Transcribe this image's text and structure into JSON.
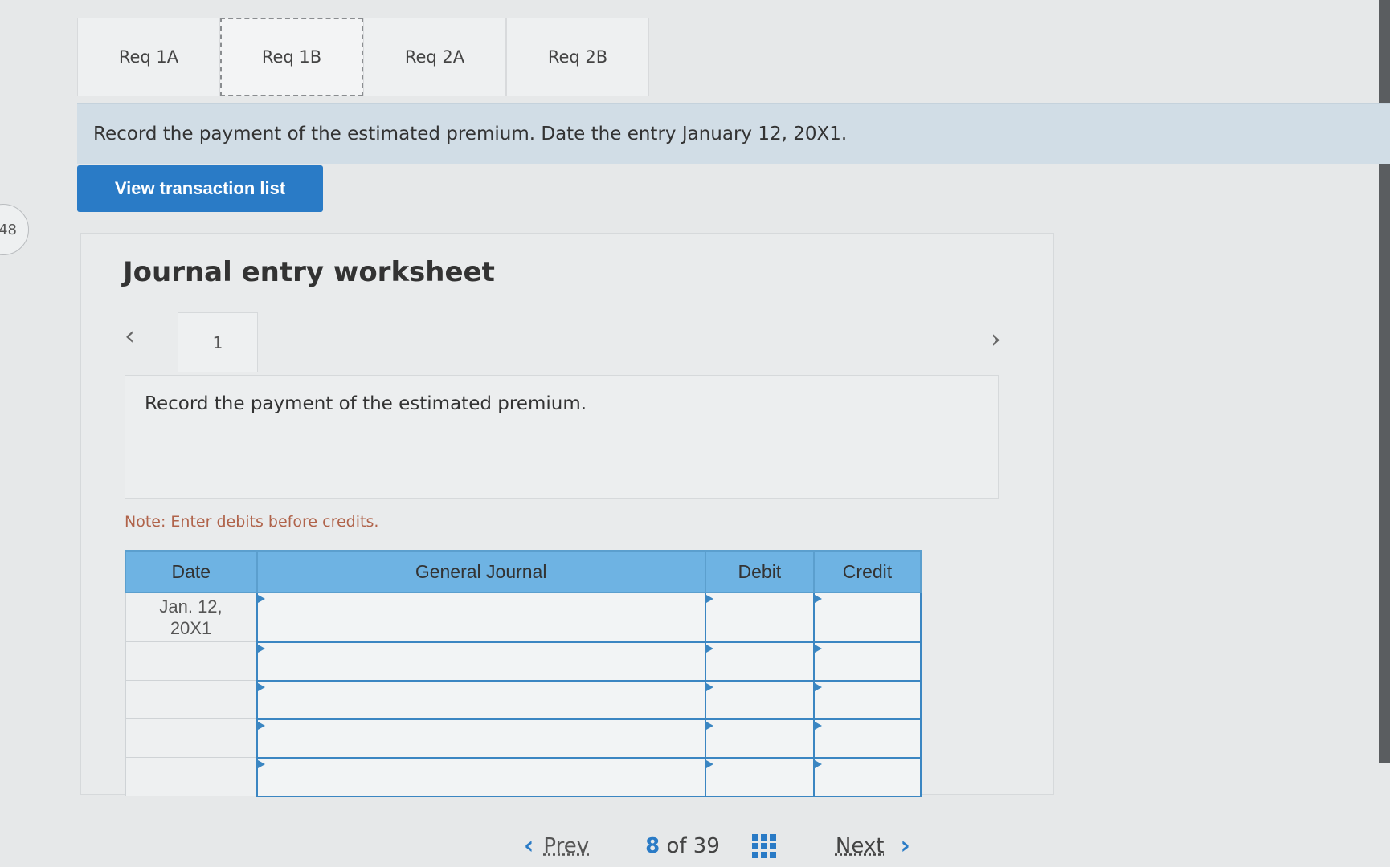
{
  "side_badge": "48",
  "tabs": [
    {
      "label": "Req 1A",
      "active": false
    },
    {
      "label": "Req 1B",
      "active": true
    },
    {
      "label": "Req 2A",
      "active": false
    },
    {
      "label": "Req 2B",
      "active": false
    }
  ],
  "instruction": "Record the payment of the estimated premium. Date the entry January 12, 20X1.",
  "view_transactions_label": "View transaction list",
  "worksheet": {
    "title": "Journal entry worksheet",
    "entry_tab": "1",
    "description": "Record the payment of the estimated premium.",
    "note": "Note: Enter debits before credits."
  },
  "journal": {
    "columns": [
      "Date",
      "General Journal",
      "Debit",
      "Credit"
    ],
    "date_first_line": "Jan. 12,",
    "date_second_line": "20X1"
  },
  "pagination": {
    "prev_label": "Prev",
    "current": "8",
    "of_label": "of",
    "total": "39",
    "next_label": "Next"
  }
}
